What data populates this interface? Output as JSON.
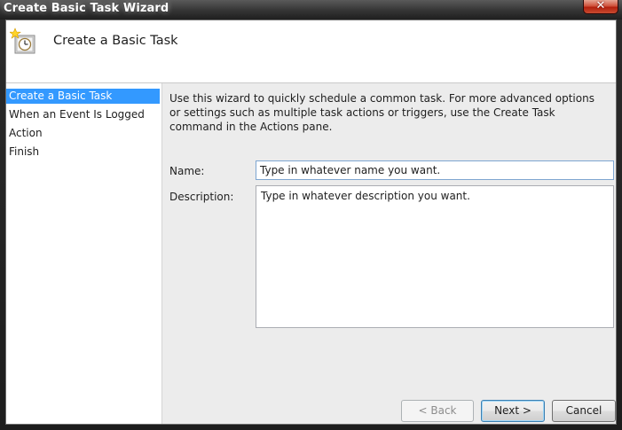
{
  "window": {
    "title": "Create Basic Task Wizard",
    "close_glyph": "✕"
  },
  "header": {
    "title": "Create a Basic Task",
    "icon": "task-clock-icon"
  },
  "steps": [
    {
      "label": "Create a Basic Task",
      "selected": true
    },
    {
      "label": "When an Event Is Logged",
      "selected": false
    },
    {
      "label": "Action",
      "selected": false
    },
    {
      "label": "Finish",
      "selected": false
    }
  ],
  "main": {
    "intro": "Use this wizard to quickly schedule a common task.  For more advanced options or settings such as multiple task actions or triggers, use the Create Task command in the Actions pane.",
    "name_label": "Name:",
    "name_value": "Type in whatever name you want.",
    "description_label": "Description:",
    "description_value": "Type in whatever description you want."
  },
  "buttons": {
    "back": "< Back",
    "next": "Next >",
    "cancel": "Cancel"
  },
  "colors": {
    "selection": "#3399ff",
    "client_background": "#ececec",
    "close_button": "#c9432c"
  }
}
